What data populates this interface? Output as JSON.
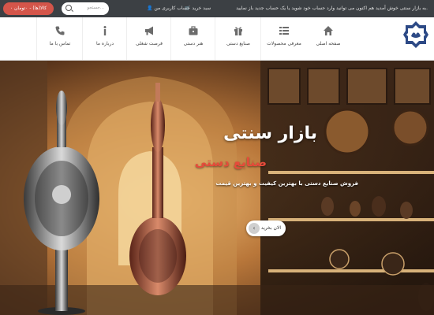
{
  "topbar": {
    "welcome": "به بازار سنتی خوش آمدید هم اکنون می توانید وارد حساب خود شوید یا یک حساب جدید باز نمایید.",
    "cart_link": "سبد خرید",
    "account_link": "حساب کاربری من",
    "search_placeholder": "جستجو...",
    "cart_button": "۰ کالا(ها) - ۰تومان"
  },
  "nav": {
    "items": [
      {
        "label": "صفحه اصلی",
        "icon": "home-icon"
      },
      {
        "label": "معرفی محصولات",
        "icon": "list-icon"
      },
      {
        "label": "صنایع دستی",
        "icon": "gift-icon"
      },
      {
        "label": "هنر دستی",
        "icon": "briefcase-icon"
      },
      {
        "label": "فرصت شغلی",
        "icon": "megaphone-icon"
      },
      {
        "label": "درباره ما",
        "icon": "info-icon"
      },
      {
        "label": "تماس با ما",
        "icon": "phone-icon"
      }
    ]
  },
  "hero": {
    "title": "بازار سنتی",
    "subtitle": "صنایع دستی",
    "description": "فروش صنایع دستی با بهترین کیفیت و بهترین قیمت",
    "button_label": "الان بخرید"
  },
  "colors": {
    "topbar": "#3c4044",
    "accent_red": "#d4554a",
    "logo_blue": "#2d4a86"
  }
}
